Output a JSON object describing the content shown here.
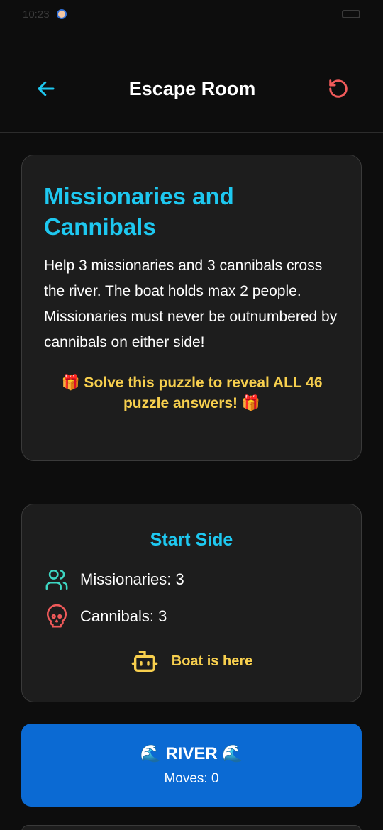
{
  "status_bar": {
    "time": "10:23"
  },
  "header": {
    "title": "Escape Room"
  },
  "intro": {
    "title": "Missionaries and Cannibals",
    "description": "Help 3 missionaries and 3 cannibals cross the river. The boat holds max 2 people. Missionaries must never be outnumbered by cannibals on either side!",
    "reward_text": "🎁 Solve this puzzle to reveal ALL 46 puzzle answers! 🎁"
  },
  "start_side": {
    "title": "Start Side",
    "missionaries_label": "Missionaries: 3",
    "cannibals_label": "Cannibals: 3",
    "boat_label": "Boat is here"
  },
  "river": {
    "label": "RIVER",
    "wave_emoji": "🌊",
    "moves_label": "Moves: 0"
  },
  "colors": {
    "accent_cyan": "#1ec8f0",
    "accent_yellow": "#f7cf4e",
    "accent_red": "#f05a5a",
    "river_blue": "#0b6ad3",
    "missionary_teal": "#3dd6c2"
  },
  "icons": {
    "back": "arrow-left-icon",
    "reset": "rotate-ccw-icon",
    "missionaries": "users-icon",
    "cannibals": "skull-icon",
    "boat": "bot-icon"
  }
}
